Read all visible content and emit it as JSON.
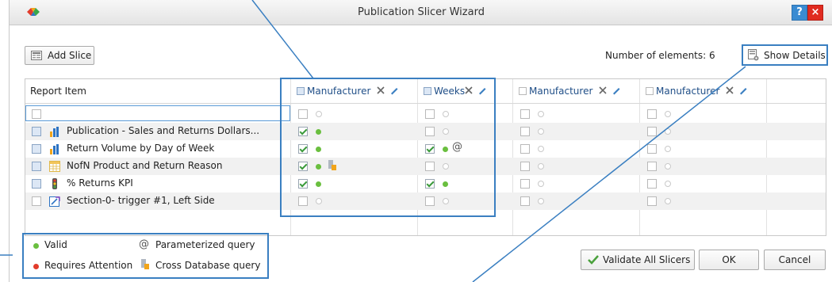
{
  "window": {
    "title": "Publication Slicer Wizard",
    "help_label": "?",
    "close_label": "×"
  },
  "toolbar": {
    "add_slice_label": "Add Slice",
    "num_elements_label": "Number of elements: 6",
    "show_details_label": "Show Details"
  },
  "grid": {
    "report_item_header": "Report Item",
    "columns": [
      {
        "label": "Manufacturer",
        "header_checked": true
      },
      {
        "label": "Weeks",
        "header_checked": true
      },
      {
        "label": "Manufacturer",
        "header_checked": false
      },
      {
        "label": "Manufacturer",
        "header_checked": false
      }
    ],
    "rows": [
      {
        "label": "",
        "icon": "none",
        "cells": [
          {
            "checked": false,
            "status": "empty"
          },
          {
            "checked": false,
            "status": "empty"
          },
          {
            "checked": false,
            "status": "empty"
          },
          {
            "checked": false,
            "status": "empty"
          }
        ]
      },
      {
        "label": "Publication - Sales and Returns Dollars...",
        "icon": "bar-chart-icon",
        "cells": [
          {
            "checked": true,
            "status": "valid"
          },
          {
            "checked": false,
            "status": "empty"
          },
          {
            "checked": false,
            "status": "empty"
          },
          {
            "checked": false,
            "status": "empty"
          }
        ]
      },
      {
        "label": "Return Volume by Day of Week",
        "icon": "bar-chart-icon",
        "cells": [
          {
            "checked": true,
            "status": "valid"
          },
          {
            "checked": true,
            "status": "valid",
            "parameterized": true
          },
          {
            "checked": false,
            "status": "empty"
          },
          {
            "checked": false,
            "status": "empty"
          }
        ]
      },
      {
        "label": "NofN Product and Return Reason",
        "icon": "grid-report-icon",
        "cells": [
          {
            "checked": true,
            "status": "valid",
            "cross_db": true
          },
          {
            "checked": false,
            "status": "empty"
          },
          {
            "checked": false,
            "status": "empty"
          },
          {
            "checked": false,
            "status": "empty"
          }
        ]
      },
      {
        "label": "% Returns KPI",
        "icon": "traffic-light-icon",
        "cells": [
          {
            "checked": true,
            "status": "valid"
          },
          {
            "checked": true,
            "status": "valid"
          },
          {
            "checked": false,
            "status": "empty"
          },
          {
            "checked": false,
            "status": "empty"
          }
        ]
      },
      {
        "label": "Section-0- trigger #1, Left Side",
        "icon": "section-trigger-icon",
        "cells": [
          {
            "checked": false,
            "status": "empty"
          },
          {
            "checked": false,
            "status": "empty"
          },
          {
            "checked": false,
            "status": "empty"
          },
          {
            "checked": false,
            "status": "empty"
          }
        ]
      }
    ]
  },
  "legend": {
    "valid_label": "Valid",
    "requires_attention_label": "Requires Attention",
    "parameterized_symbol": "@",
    "parameterized_label": "Parameterized query",
    "cross_db_label": "Cross Database query"
  },
  "footer": {
    "validate_all_label": "Validate All Slicers",
    "ok_label": "OK",
    "cancel_label": "Cancel"
  },
  "colors": {
    "accent": "#3a7fc1",
    "valid": "#6abf3f",
    "attention": "#e23b2b",
    "close": "#e02b20",
    "help": "#3a8bd2"
  }
}
